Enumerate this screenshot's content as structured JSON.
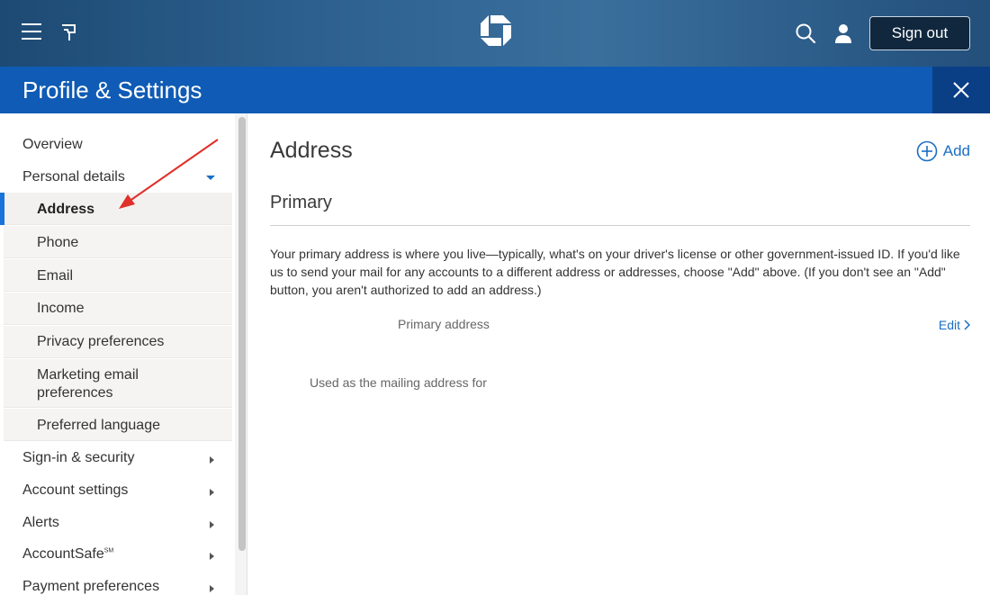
{
  "header": {
    "signout_label": "Sign out",
    "icons": [
      "menu-icon",
      "flag-icon",
      "chase-logo",
      "search-icon",
      "user-icon"
    ]
  },
  "titlebar": {
    "title": "Profile & Settings"
  },
  "sidebar": {
    "items": [
      {
        "label": "Overview"
      },
      {
        "label": "Personal details",
        "expanded": true
      },
      {
        "label": "Sign-in & security"
      },
      {
        "label": "Account settings"
      },
      {
        "label": "Alerts"
      },
      {
        "label": "AccountSafe",
        "superscript": "SM"
      },
      {
        "label": "Payment preferences"
      }
    ],
    "subitems": [
      {
        "label": "Address",
        "active": true
      },
      {
        "label": "Phone"
      },
      {
        "label": "Email"
      },
      {
        "label": "Income"
      },
      {
        "label": "Privacy preferences"
      },
      {
        "label": "Marketing email preferences"
      },
      {
        "label": "Preferred language"
      }
    ]
  },
  "main": {
    "heading": "Address",
    "add_label": "Add",
    "section_title": "Primary",
    "description": "Your primary address is where you live—typically, what's on your driver's license or other government-issued ID. If you'd like us to send your mail for any accounts to a different address or addresses, choose \"Add\" above. (If you don't see an \"Add\" button, you aren't authorized to add an address.)",
    "primary_address_label": "Primary address",
    "edit_label": "Edit",
    "mailing_label": "Used as the mailing address for"
  },
  "colors": {
    "brand_blue": "#0f5bb5",
    "link_blue": "#1a6ec4",
    "annotation_red": "#e0302a"
  }
}
